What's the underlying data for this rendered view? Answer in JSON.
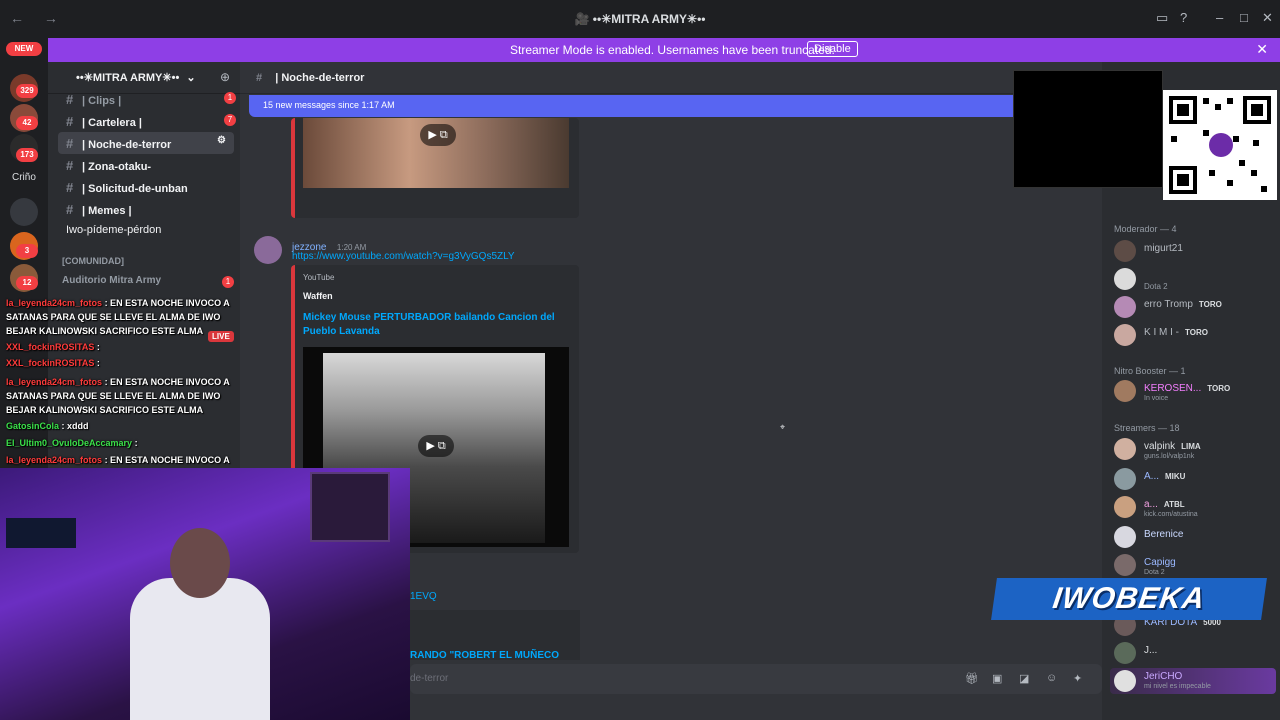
{
  "window": {
    "title": "🎥 ••✳MITRA ARMY✳••",
    "nav": "← →"
  },
  "banner": {
    "text": "Streamer Mode is enabled. Usernames have been truncated.",
    "button": "Disable",
    "close": "✕"
  },
  "servers": {
    "new_badge": "NEW",
    "badges": [
      "329",
      "42",
      "173",
      "3",
      "12"
    ],
    "label_crino": "Criño"
  },
  "sidebar": {
    "guild": "••✳MITRA ARMY✳••",
    "channels": [
      {
        "label": "| Clips |",
        "badge": "1"
      },
      {
        "label": "| Cartelera |",
        "badge": "7"
      },
      {
        "label": "| Noche-de-terror",
        "badge": ""
      },
      {
        "label": "| Zona-otaku-",
        "badge": ""
      },
      {
        "label": "| Solicitud-de-unban",
        "badge": ""
      },
      {
        "label": "| Memes |",
        "badge": ""
      },
      {
        "label": "Iwo-pídeme-pérdon",
        "badge": ""
      }
    ],
    "category": "[COMUNIDAD]",
    "voice": "Auditorio Mitra Army",
    "voice_badge": "1",
    "live": "LIVE"
  },
  "chat": {
    "channel": "| Noche-de-terror",
    "new_messages": "15 new messages since 1:17 AM",
    "author": "jezzone",
    "time": "1:20 AM",
    "url": "https://www.youtube.com/watch?v=g3VyGQs5ZLY",
    "embed_provider": "YouTube",
    "embed_author": "Waffen",
    "embed_title": "Mickey Mouse PERTURBADOR bailando Cancion del Pueblo Lavanda",
    "partial_link": "1EVQ",
    "partial_title": "RANDO \"ROBERT EL MUÑECO",
    "input_placeholder": "de-terror"
  },
  "overlay_chat": [
    {
      "user": "la_leyenda24cm_fotos",
      "text": ": EN ESTA NOCHE INVOCO A SATANAS PARA QUE SE LLEVE EL ALMA DE IWO BEJAR KALINOWSKI SACRIFICO ESTE ALMA"
    },
    {
      "user": "XXL_fockinROSITAS",
      "text": ":"
    },
    {
      "user": "XXL_fockinROSITAS",
      "text": ":"
    },
    {
      "user": "la_leyenda24cm_fotos",
      "text": ": EN ESTA NOCHE INVOCO A SATANAS PARA QUE SE LLEVE EL ALMA DE IWO BEJAR KALINOWSKI SACRIFICO ESTE ALMA"
    },
    {
      "user": "GatosinCola",
      "text": ": xddd"
    },
    {
      "user": "El_Ultim0_OvuloDeAccamary",
      "text": ":"
    },
    {
      "user": "la_leyenda24cm_fotos",
      "text": ": EN ESTA NOCHE INVOCO A SATANAS PARA QUE SE LLEVE EL ALMA DE IWO BEJAR KALINOWSKI SACRIFICO ESTE ALMA"
    }
  ],
  "members": {
    "groups": [
      {
        "label": "Moderador — 4"
      },
      {
        "label": "Nitro Booster — 1"
      },
      {
        "label": "Streamers — 18"
      }
    ],
    "list": [
      {
        "name": "migurt21",
        "sub": "",
        "tag": ""
      },
      {
        "name": "",
        "sub": "Dota 2",
        "tag": ""
      },
      {
        "name": "erro Tromp",
        "sub": "",
        "tag": "TORO"
      },
      {
        "name": "K I M I -",
        "sub": "",
        "tag": "TORO"
      },
      {
        "name": "KEROSEN...",
        "sub": "In voice",
        "tag": "TORO"
      },
      {
        "name": "valpink",
        "sub": "guns.lol/valp1nk",
        "tag": "LIMA"
      },
      {
        "name": "A...",
        "sub": "",
        "tag": "MIKU"
      },
      {
        "name": "a...",
        "sub": "kick.com/atustina",
        "tag": "ATBL"
      },
      {
        "name": "Berenice",
        "sub": "",
        "tag": ""
      },
      {
        "name": "Capigg",
        "sub": "Dota 2",
        "tag": ""
      },
      {
        "name": "KARI DOTA",
        "sub": "",
        "tag": "5000"
      },
      {
        "name": "J...",
        "sub": "",
        "tag": ""
      },
      {
        "name": "JeriCHO",
        "sub": "mi nivel es impecable",
        "tag": ""
      }
    ]
  },
  "logo": {
    "text": "IWOBEKA"
  },
  "colors": {
    "accent": "#8e3fe6",
    "link": "#00a8fc",
    "blurple": "#5865f2",
    "danger": "#da373c"
  }
}
